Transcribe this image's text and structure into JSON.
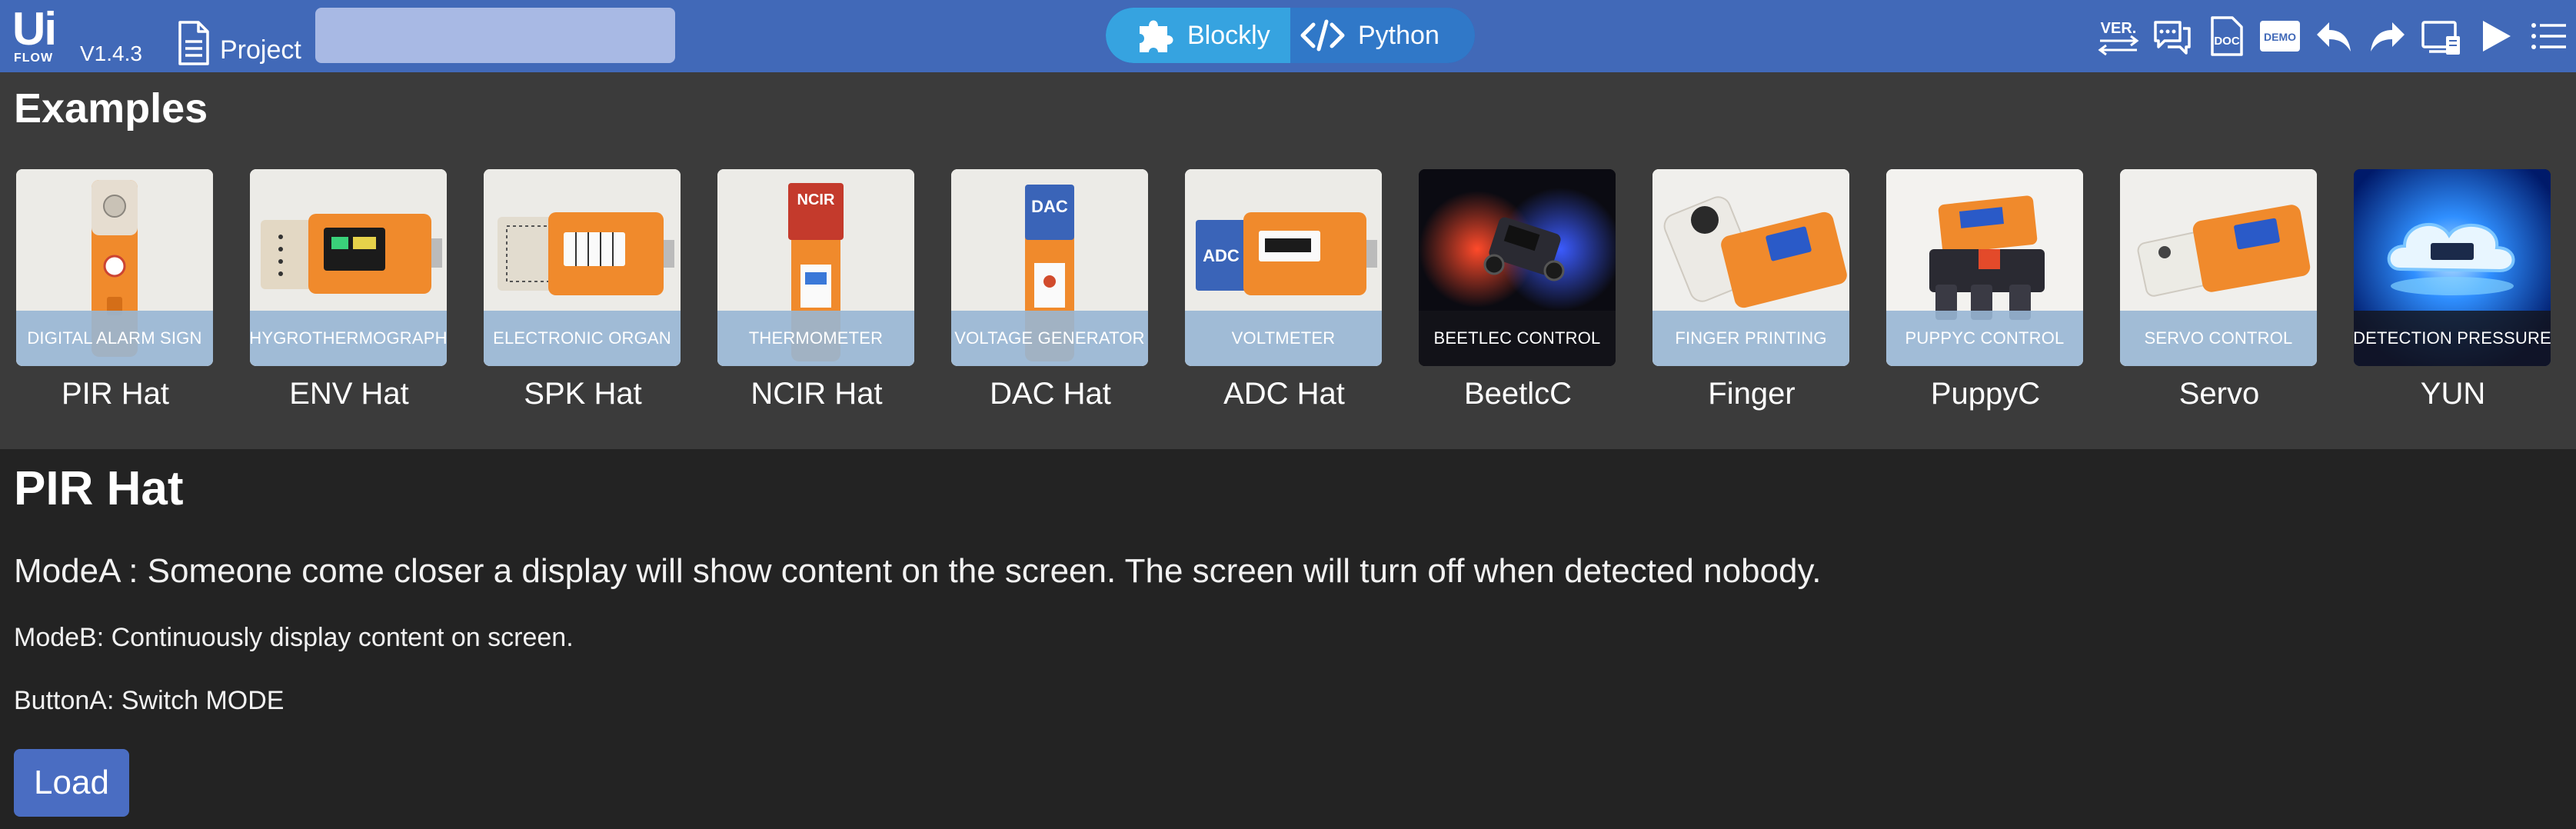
{
  "app": {
    "logo_text": "Ui",
    "logo_sub": "FLOW",
    "version": "V1.4.3",
    "project_label": "Project",
    "name_input_value": "",
    "modes": [
      {
        "label": "Blockly",
        "icon": "puzzle-icon",
        "active": true
      },
      {
        "label": "Python",
        "icon": "code-icon",
        "active": false
      }
    ],
    "toolbar": [
      {
        "name": "version-button",
        "icon": "version-icon",
        "text": "VER."
      },
      {
        "name": "chat-button",
        "icon": "chat-icon",
        "text": ""
      },
      {
        "name": "doc-button",
        "icon": "doc-icon",
        "text": "DOC"
      },
      {
        "name": "demo-button",
        "icon": "demo-icon",
        "text": "DEMO"
      },
      {
        "name": "undo-button",
        "icon": "undo-icon",
        "text": ""
      },
      {
        "name": "redo-button",
        "icon": "redo-icon",
        "text": ""
      },
      {
        "name": "device-button",
        "icon": "device-icon",
        "text": ""
      },
      {
        "name": "run-button",
        "icon": "play-icon",
        "text": ""
      },
      {
        "name": "menu-button",
        "icon": "menu-icon",
        "text": ""
      }
    ],
    "colors": {
      "topbar": "#4169b8",
      "blockly": "#36a3e0",
      "python": "#3078c8",
      "load": "#4a6dc2"
    }
  },
  "examples": {
    "title": "Examples",
    "items": [
      {
        "name": "PIR Hat",
        "caption": "DIGITAL ALARM SIGN",
        "theme": "light"
      },
      {
        "name": "ENV Hat",
        "caption": "HYGROTHERMOGRAPH",
        "theme": "light"
      },
      {
        "name": "SPK Hat",
        "caption": "ELECTRONIC ORGAN",
        "theme": "light"
      },
      {
        "name": "NCIR Hat",
        "caption": "THERMOMETER",
        "theme": "light",
        "badge": "NCIR"
      },
      {
        "name": "DAC Hat",
        "caption": "VOLTAGE GENERATOR",
        "theme": "light",
        "badge": "DAC"
      },
      {
        "name": "ADC Hat",
        "caption": "VOLTMETER",
        "theme": "light",
        "badge": "ADC"
      },
      {
        "name": "BeetlcC",
        "caption": "BEETLEC CONTROL",
        "theme": "dark"
      },
      {
        "name": "Finger",
        "caption": "FINGER PRINTING",
        "theme": "light"
      },
      {
        "name": "PuppyC",
        "caption": "PUPPYC CONTROL",
        "theme": "light"
      },
      {
        "name": "Servo",
        "caption": "SERVO CONTROL",
        "theme": "light"
      },
      {
        "name": "YUN",
        "caption": "DETECTION PRESSURE",
        "theme": "dark"
      }
    ]
  },
  "detail": {
    "title": "PIR Hat",
    "line1": "ModeA : Someone come closer a display will show content on the screen. The screen will turn off when detected nobody.",
    "line2": "ModeB: Continuously display content on screen.",
    "line3": "ButtonA: Switch MODE",
    "load_label": "Load"
  }
}
